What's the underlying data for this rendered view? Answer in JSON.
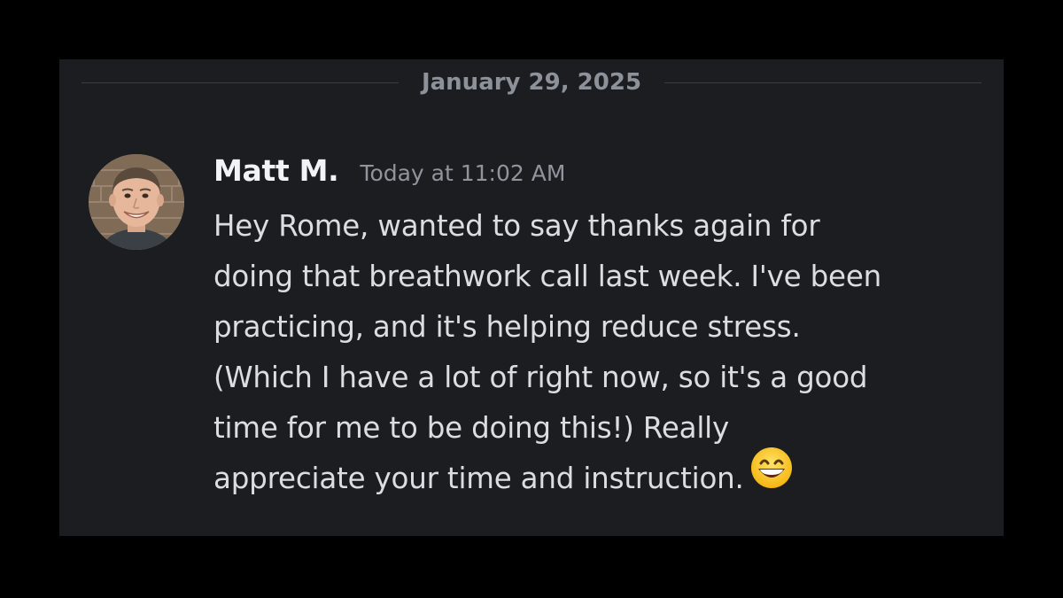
{
  "date_divider": {
    "label": "January 29, 2025"
  },
  "message": {
    "author": "Matt M.",
    "timestamp": "Today at 11:02 AM",
    "lines": [
      "Hey Rome, wanted to say thanks again for",
      "doing that breathwork call last week. I've been",
      "practicing, and it's helping reduce stress.",
      "(Which I have a lot of right now, so it's a good",
      "time for me to be doing this!) Really",
      "appreciate your time and instruction."
    ],
    "emoji": "grinning-face-with-smiling-eyes"
  },
  "colors": {
    "background": "#000000",
    "panel": "#1c1d21",
    "author": "#f2f3f5",
    "timestamp": "#90949c",
    "body_text": "#dbdee1",
    "divider": "#3a3c42"
  }
}
